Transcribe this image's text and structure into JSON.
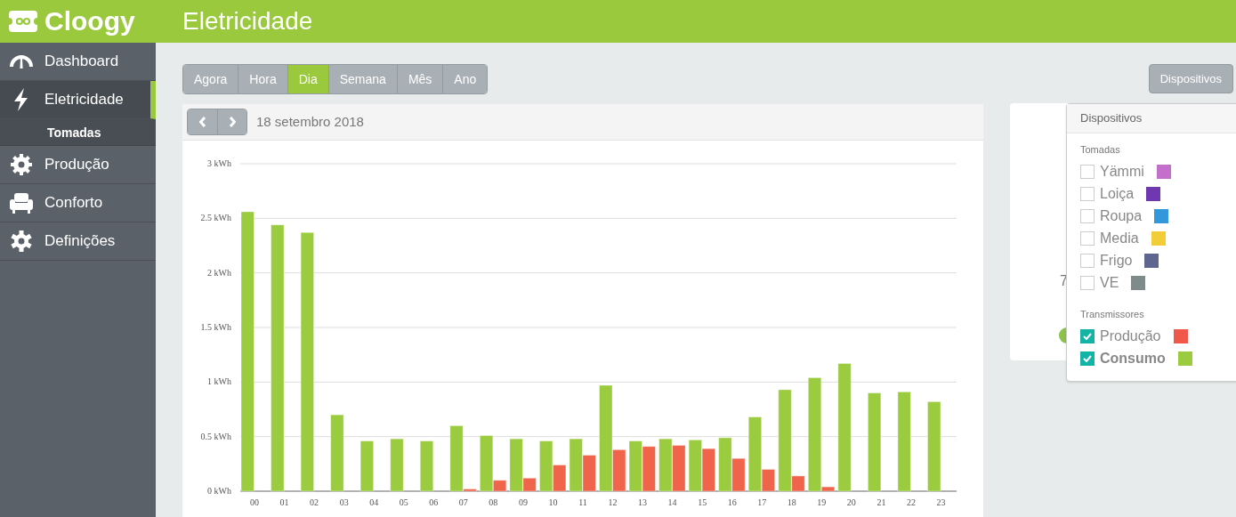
{
  "brand": "Cloogy",
  "page_title": "Eletricidade",
  "sidebar": {
    "items": [
      {
        "label": "Dashboard",
        "selected": false
      },
      {
        "label": "Eletricidade",
        "selected": true,
        "children": [
          {
            "label": "Tomadas",
            "selected": false
          }
        ]
      },
      {
        "label": "Produção",
        "selected": false
      },
      {
        "label": "Conforto",
        "selected": false
      },
      {
        "label": "Definições",
        "selected": false
      }
    ]
  },
  "periods": [
    {
      "label": "Agora",
      "selected": false
    },
    {
      "label": "Hora",
      "selected": false
    },
    {
      "label": "Dia",
      "selected": true
    },
    {
      "label": "Semana",
      "selected": false
    },
    {
      "label": "Mês",
      "selected": false
    },
    {
      "label": "Ano",
      "selected": false
    }
  ],
  "date": "18 setembro 2018",
  "chart_data": {
    "type": "bar",
    "categories": [
      "00",
      "01",
      "02",
      "03",
      "04",
      "05",
      "06",
      "07",
      "08",
      "09",
      "10",
      "11",
      "12",
      "13",
      "14",
      "15",
      "16",
      "17",
      "18",
      "19",
      "20",
      "21",
      "22",
      "23"
    ],
    "ylim": [
      0,
      3
    ],
    "grid": true,
    "yticks": [
      {
        "value": 0,
        "label": "0 kWh"
      },
      {
        "value": 0.5,
        "label": "0.5 kWh"
      },
      {
        "value": 1,
        "label": "1 kWh"
      },
      {
        "value": 1.5,
        "label": "1.5 kWh"
      },
      {
        "value": 2,
        "label": "2 kWh"
      },
      {
        "value": 2.5,
        "label": "2.5 kWh"
      },
      {
        "value": 3,
        "label": "3 kWh"
      }
    ],
    "series": [
      {
        "color": "#9bcb3f",
        "values": [
          2.56,
          2.44,
          2.37,
          0.7,
          0.46,
          0.48,
          0.46,
          0.6,
          0.51,
          0.48,
          0.46,
          0.48,
          0.97,
          0.46,
          0.48,
          0.47,
          0.49,
          0.68,
          0.93,
          1.04,
          1.17,
          0.9,
          0.91,
          0.82
        ]
      },
      {
        "color": "#f0644c",
        "values": [
          null,
          null,
          null,
          null,
          null,
          null,
          null,
          0.02,
          0.1,
          0.12,
          0.24,
          0.33,
          0.38,
          0.41,
          0.42,
          0.39,
          0.3,
          0.2,
          0.14,
          0.04,
          null,
          null,
          null,
          null
        ]
      }
    ]
  },
  "side_card": {
    "value_fragment": "7"
  },
  "devices_button": "Dispositivos",
  "devices_menu": {
    "title": "Dispositivos",
    "groups": [
      {
        "label": "Tomadas",
        "items": [
          {
            "label": "Yämmi",
            "checked": false,
            "color": "#c56fcc"
          },
          {
            "label": "Loiça",
            "checked": false,
            "color": "#7038b0"
          },
          {
            "label": "Roupa",
            "checked": false,
            "color": "#3397dc"
          },
          {
            "label": "Media",
            "checked": false,
            "color": "#f2cd38"
          },
          {
            "label": "Frigo",
            "checked": false,
            "color": "#5e6690"
          },
          {
            "label": "VE",
            "checked": false,
            "color": "#7f8b8b"
          }
        ]
      },
      {
        "label": "Transmissores",
        "items": [
          {
            "label": "Produção",
            "checked": true,
            "color": "#f0584a"
          },
          {
            "label": "Consumo",
            "checked": true,
            "bold": true,
            "color": "#9bcb3f"
          }
        ]
      }
    ]
  }
}
